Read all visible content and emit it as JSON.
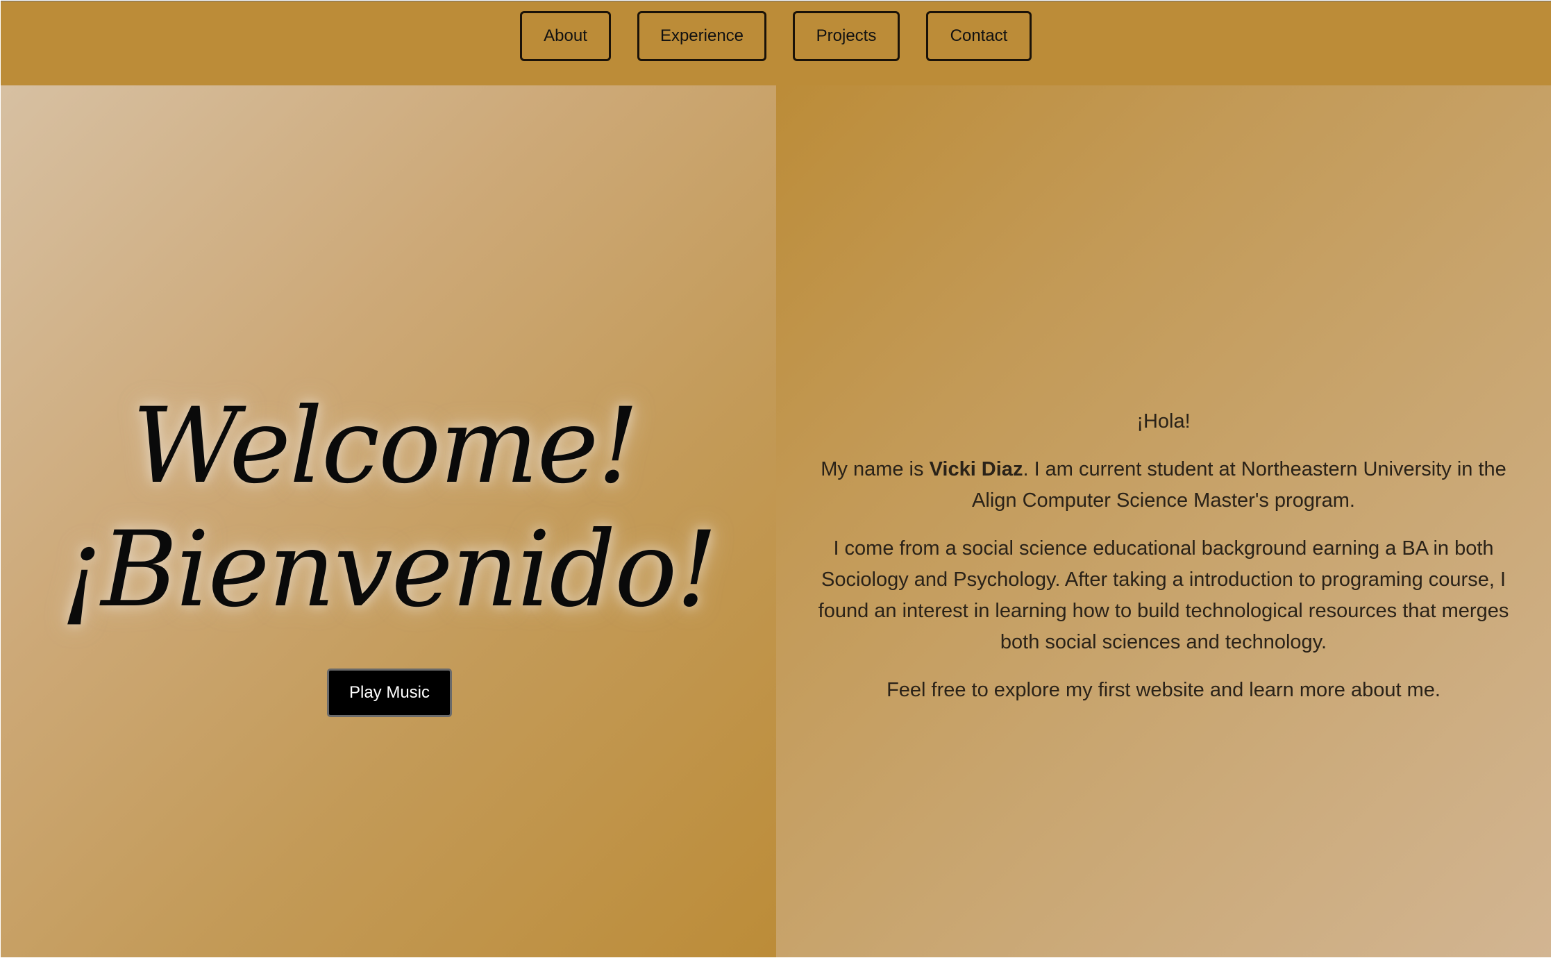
{
  "nav": {
    "items": [
      {
        "label": "About"
      },
      {
        "label": "Experience"
      },
      {
        "label": "Projects"
      },
      {
        "label": "Contact"
      }
    ]
  },
  "hero": {
    "welcome_heading": "Welcome!",
    "bienvenido_heading": "¡Bienvenido!",
    "play_button_label": "Play Music"
  },
  "about": {
    "greeting": "¡Hola!",
    "intro_prefix": "My name is ",
    "name": "Vicki Diaz",
    "intro_suffix": ". I am current student at Northeastern University in the Align Computer Science Master's program.",
    "background": "I come from a social science educational background earning a BA in both Sociology and Psychology. After taking a introduction to programing course, I found an interest in learning how to build technological resources that merges both social sciences and technology.",
    "closing": "Feel free to explore my first website and learn more about me."
  },
  "colors": {
    "navbar_bg": "#bc8c38",
    "left_gradient_start": "#d7c0a2",
    "left_gradient_end": "#bc8c38",
    "right_gradient_start": "#bc8c38",
    "right_gradient_end": "#d2b592",
    "button_bg": "#000000",
    "text_dark": "#2a2218"
  }
}
